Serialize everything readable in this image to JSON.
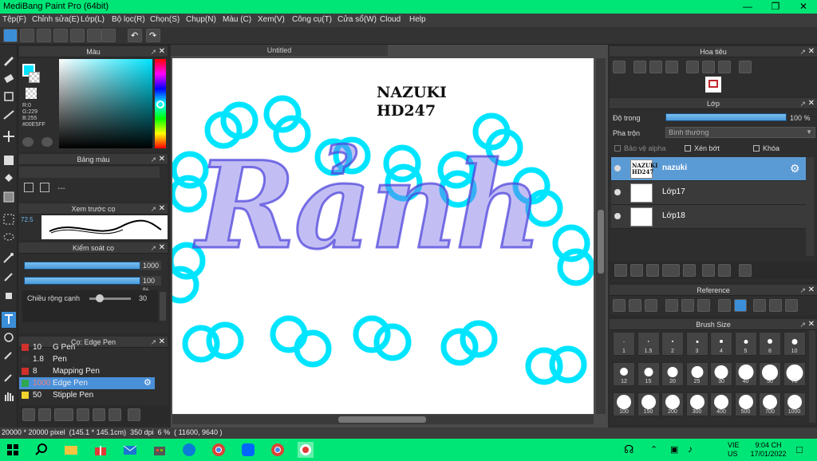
{
  "window": {
    "title": "MediBang Paint Pro (64bit)"
  },
  "menu": [
    "Tệp(F)",
    "Chỉnh sửa(E)",
    "Lớp(L)",
    "Bộ lọc(R)",
    "Chọn(S)",
    "Chụp(N)",
    "Màu (C)",
    "Xem(V)",
    "Công cụ(T)",
    "Cửa sổ(W)",
    "Cloud",
    "Help"
  ],
  "panels": {
    "color": {
      "title": "Màu",
      "r": "R:0",
      "g": "G:229",
      "b": "B:255",
      "hex": "#00E5FF",
      "accent": "#00e5ff"
    },
    "palette": {
      "title": "Bảng màu",
      "empty": "---"
    },
    "brush_preview": {
      "title": "Xem trước cọ",
      "zoom": "72.5"
    },
    "brush_control": {
      "title": "Kiểm soát cọ",
      "size": "1000",
      "opacity": "100 %",
      "edge_width_label": "Chiều rộng cạnh",
      "edge_width_value": "30"
    },
    "brush_list": {
      "title": "Cọ: Edge Pen",
      "items": [
        {
          "size": "10",
          "name": "G Pen",
          "color": "#d0312d"
        },
        {
          "size": "1.8",
          "name": "Pen",
          "color": "#333333"
        },
        {
          "size": "8",
          "name": "Mapping Pen",
          "color": "#d0312d"
        },
        {
          "size": "1000",
          "name": "Edge Pen",
          "color": "#2fa84f"
        },
        {
          "size": "50",
          "name": "Stipple Pen",
          "color": "#f2d22e"
        }
      ]
    },
    "navigator": {
      "title": "Hoa tiêu"
    },
    "layer": {
      "title": "Lớp",
      "opacity_label": "Độ trong",
      "opacity_value": "100 %",
      "blend_label": "Pha trộn",
      "blend_value": "Bình thường",
      "protect_alpha": "Bảo vệ alpha",
      "clip": "Xén bớt",
      "lock": "Khóa",
      "layers": [
        {
          "name": "nazuki",
          "thumb": "NAZUKI HD247"
        },
        {
          "name": "Lớp17"
        },
        {
          "name": "Lớp18"
        }
      ]
    },
    "reference": {
      "title": "Reference"
    },
    "brush_size": {
      "title": "Brush Size",
      "sizes": [
        "1",
        "1.5",
        "2",
        "3",
        "4",
        "5",
        "8",
        "10",
        "12",
        "15",
        "20",
        "25",
        "30",
        "40",
        "50",
        "70",
        "100",
        "150",
        "200",
        "300",
        "400",
        "500",
        "700",
        "1000"
      ]
    }
  },
  "canvas": {
    "tab": "Untitled",
    "signature_line1": "NAZUKI",
    "signature_line2": "HD247",
    "lettering": "Rảnh",
    "circle_color": "#00e5ff"
  },
  "status": "20000 * 20000 pixel  (145.1 * 145.1cm)  350 dpi  6 %  ( 11600, 9640 )",
  "taskbar": {
    "lang1": "VIE",
    "lang2": "US",
    "time": "9:04 CH",
    "date": "17/01/2022",
    "accent": "#00e676"
  }
}
